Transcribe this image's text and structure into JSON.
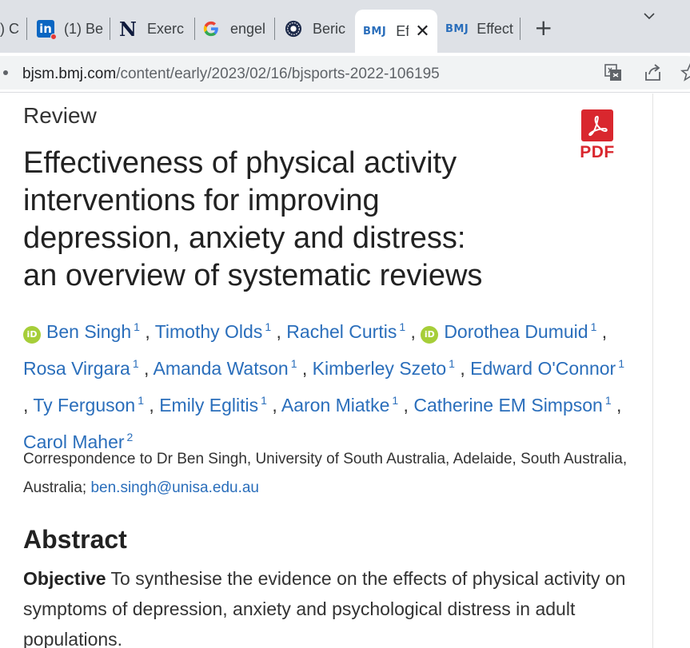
{
  "browser": {
    "tabs": [
      {
        "title": ") C",
        "icon": "generic-page-icon",
        "active": false
      },
      {
        "title": "(1) Be",
        "icon": "linkedin-icon",
        "favicon_text": "in",
        "active": false
      },
      {
        "title": "Exerc",
        "icon": "n-logo-icon",
        "favicon_text": "N",
        "active": false
      },
      {
        "title": "engel",
        "icon": "google-icon",
        "active": false
      },
      {
        "title": "Beric",
        "icon": "seal-icon",
        "active": false
      },
      {
        "title": "Ef",
        "icon": "bmj-icon",
        "favicon_text": "BMJ",
        "active": true
      },
      {
        "title": "Effect",
        "icon": "bmj-icon",
        "favicon_text": "BMJ",
        "active": false
      }
    ],
    "close_glyph": "✕",
    "new_tab_glyph": "+",
    "url_host": "bjsm.bmj.com",
    "url_path": "/content/early/2023/02/16/bjsports-2022-106195"
  },
  "article": {
    "type": "Review",
    "pdf_label": "PDF",
    "title_lines": [
      "Effectiveness of physical activity",
      "interventions for improving",
      "depression, anxiety and distress:",
      "an overview of systematic reviews"
    ],
    "orcid_text": "iD",
    "authors": [
      {
        "name": "Ben Singh",
        "aff": "1",
        "orcid": true
      },
      {
        "name": "Timothy Olds",
        "aff": "1",
        "orcid": false
      },
      {
        "name": "Rachel Curtis",
        "aff": "1",
        "orcid": false
      },
      {
        "name": "Dorothea Dumuid",
        "aff": "1",
        "orcid": true
      },
      {
        "name": "Rosa Virgara",
        "aff": "1",
        "orcid": false
      },
      {
        "name": "Amanda Watson",
        "aff": "1",
        "orcid": false
      },
      {
        "name": "Kimberley Szeto",
        "aff": "1",
        "orcid": false
      },
      {
        "name": "Edward O'Connor",
        "aff": "1",
        "orcid": false
      },
      {
        "name": "Ty Ferguson",
        "aff": "1",
        "orcid": false
      },
      {
        "name": "Emily Eglitis",
        "aff": "1",
        "orcid": false
      },
      {
        "name": "Aaron Miatke",
        "aff": "1",
        "orcid": false
      },
      {
        "name": "Catherine EM Simpson",
        "aff": "1",
        "orcid": false
      },
      {
        "name": "Carol Maher",
        "aff": "2",
        "orcid": false
      }
    ],
    "correspondence_prefix": "Correspondence to Dr Ben Singh, University of South Australia, Adelaide, South Australia, Australia; ",
    "correspondence_email": "ben.singh@unisa.edu.au",
    "abstract_heading": "Abstract",
    "objective_label": "Objective",
    "objective_text": " To synthesise the evidence on the effects of physical activity on symptoms of depression, anxiety and psychological distress in adult populations."
  },
  "colors": {
    "link": "#2a6ebb",
    "orcid": "#a6ce39",
    "pdf": "#d9272e",
    "tabstrip": "#dee1e6"
  }
}
